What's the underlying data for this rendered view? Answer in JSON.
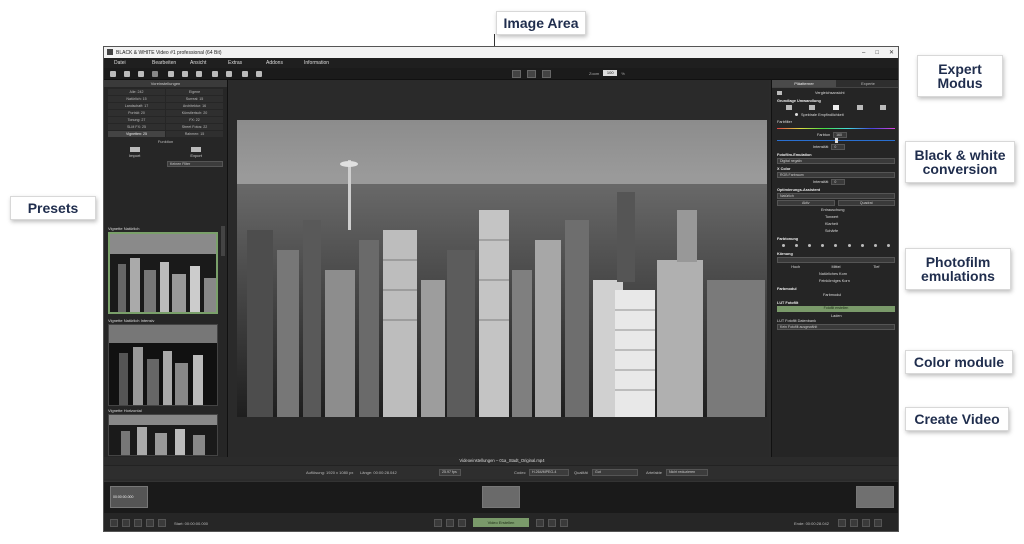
{
  "callouts": {
    "image_area": "Image Area",
    "expert_mode": "Expert\nModus",
    "bw_conversion": "Black & white\nconversion",
    "presets": "Presets",
    "photofilm": "Photofilm\nemulations",
    "color_module": "Color module",
    "create_video": "Create Video"
  },
  "window": {
    "title": "BLACK & WHITE Video #1 professional (64 Bit)",
    "controls": [
      "–",
      "□",
      "✕"
    ]
  },
  "menu": [
    "Datei",
    "Bearbeiten",
    "Ansicht",
    "Extras",
    "Addons",
    "Information"
  ],
  "toolbar": {
    "zoom_label": "Zoom",
    "zoom_value": "100",
    "zoom_unit": "%"
  },
  "left_panel": {
    "header": "Voreinstellungen",
    "categories": [
      {
        "label": "Alle: 242",
        "selected": false
      },
      {
        "label": "Eigene",
        "selected": false
      },
      {
        "label": "Natürlich: 15",
        "selected": false
      },
      {
        "label": "Surreal: 15",
        "selected": false
      },
      {
        "label": "Landschaft: 17",
        "selected": false
      },
      {
        "label": "Architektur: 16",
        "selected": false
      },
      {
        "label": "Porträt: 20",
        "selected": false
      },
      {
        "label": "Künstlerisch: 20",
        "selected": false
      },
      {
        "label": "Tonung: 27",
        "selected": false
      },
      {
        "label": "FX: 22",
        "selected": false
      },
      {
        "label": "SLM FX: 25",
        "selected": false
      },
      {
        "label": "Street Fotos: 22",
        "selected": false
      },
      {
        "label": "Vignetten: 25",
        "selected": true
      },
      {
        "label": "Rahmen: 15",
        "selected": false
      }
    ],
    "functions_label": "Funktion",
    "import_label": "Import",
    "export_label": "Export",
    "filter_value": "Keinen Filter",
    "presets": [
      {
        "title": "Vignette Natürlich"
      },
      {
        "title": "Vignette Natürlich Intensiv"
      },
      {
        "title": "Vignette Horizontal"
      }
    ]
  },
  "right_panel": {
    "tabs": [
      {
        "label": "Pläatterner",
        "active": true
      },
      {
        "label": "Experte",
        "active": false
      }
    ],
    "compare_label": "Vergleichsansicht",
    "grundlage": "Grundlage Umwandlung",
    "spektral": "Spektrale Empfindlichkeit",
    "farbfilter": "Farbfilter",
    "farbton_label": "Farbton",
    "farbton_value": "160",
    "intensitaet_label": "Intensität",
    "intensitaet_value": "0",
    "fotofilm_label": "Fotofilm-Emulation",
    "fotofilm_value": "Digital negativ",
    "xcolor_label": "X Color",
    "xcolor_value": "RGB Farbraum",
    "intensitaet2_value": "0",
    "optimierung_label": "Optimierungs-Assistent",
    "optimierung_value": "Natürlich",
    "aktiv_label": "Aktiv",
    "quadrat_label": "Quadrat",
    "options": [
      "Entrauschung",
      "Tonwert",
      "Klarheit",
      "Schärfe"
    ],
    "farbtonung_label": "Farbtonung",
    "koernung_label": "Körnung",
    "hoch_label": "Hoch",
    "mittel_label": "Mittel",
    "tief_label": "Tief",
    "natuerlich_korn": "Natürliches Korn",
    "feinkorn": "Feinkörniges Korn",
    "farbmodul_label": "Farbmodul",
    "farbmodul_btn": "Farbmodul",
    "lut_label": "LUT Fotofilt",
    "lut_btn": "Fotofilt erstellen",
    "lut_sub": "Laden",
    "lut_db_label": "LUT Fotofilt Datenbank",
    "lut_db_value": "Kein Fotofilt ausgewählt"
  },
  "video": {
    "settings_label": "Videoeinstellungen – 01a_Stadt_Original.mp4",
    "aufloesung": "Auflösung: 1920 x 1080 px",
    "laenge": "Länge: 00:00:28.042",
    "fps": "25.97 fps",
    "codec_label": "Codec",
    "codec_value": "H.264/MPEG-4",
    "qualitaet_label": "Qualität",
    "qualitaet_value": "Gut",
    "artefakte_label": "Artefakte",
    "artefakte_value": "Nicht reduzieren",
    "clip_time": "00:00:00.000",
    "start": "Start: 00:00:00.000",
    "end": "Ende: 00:00:28.042",
    "create_btn": "Video Erstellen"
  }
}
